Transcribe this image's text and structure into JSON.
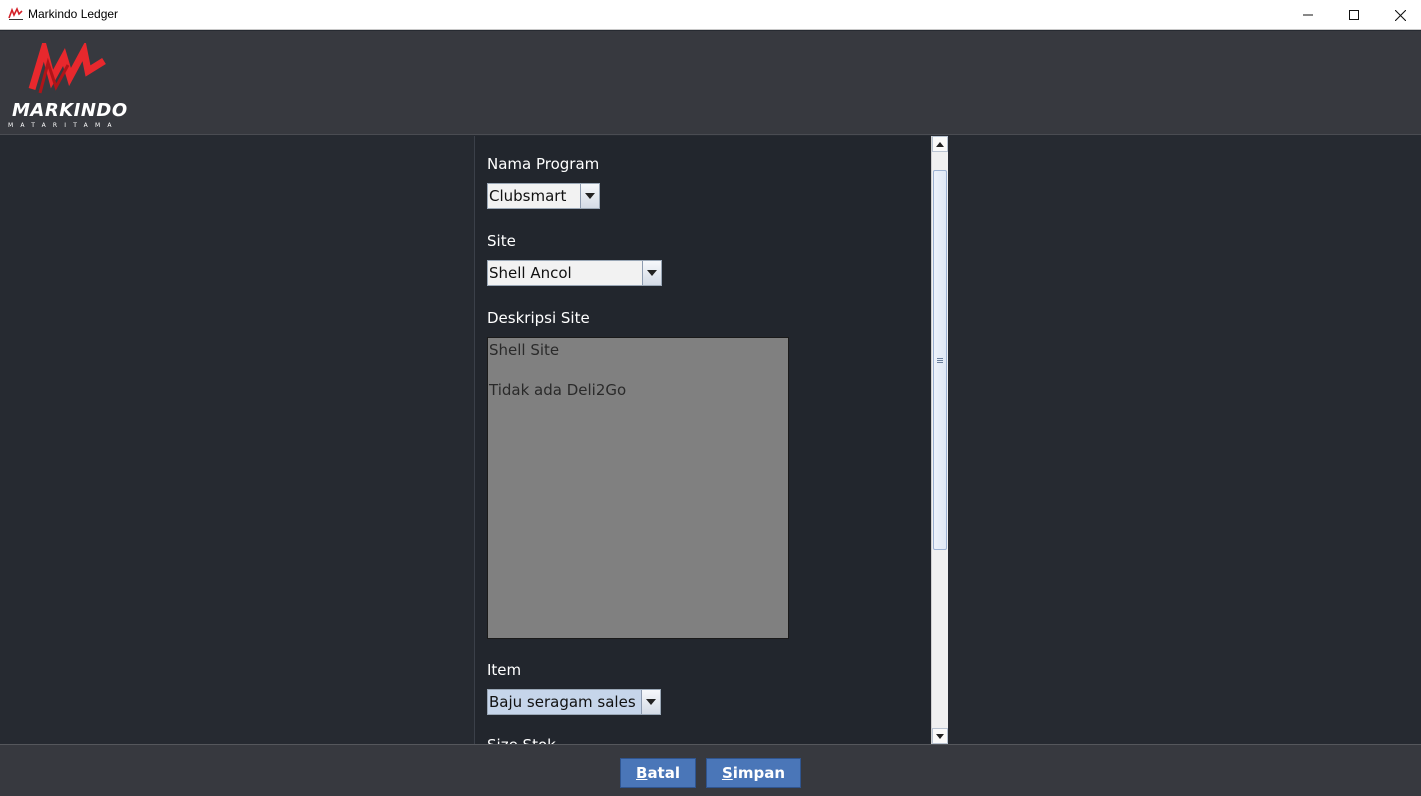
{
  "window": {
    "title": "Markindo Ledger",
    "minimize_icon": "minimize-icon",
    "maximize_icon": "maximize-icon",
    "close_icon": "close-icon"
  },
  "header": {
    "logo_text": "MARKINDO",
    "logo_subtext": "MATARITAMA"
  },
  "form": {
    "program_label": "Nama Program",
    "program_value": "Clubsmart",
    "site_label": "Site",
    "site_value": "Shell Ancol",
    "description_label": "Deskripsi Site",
    "description_lines": [
      "Shell Site",
      "Tidak ada Deli2Go"
    ],
    "item_label": "Item",
    "item_value": "Baju seragam sales",
    "next_label_partial": "Size Stok"
  },
  "footer": {
    "cancel_mnemonic": "B",
    "cancel_rest": "atal",
    "save_mnemonic": "S",
    "save_rest": "impan"
  },
  "colors": {
    "accent": "#4a76b8",
    "logo_red": "#e8282d",
    "panel_bg": "#22262d"
  }
}
